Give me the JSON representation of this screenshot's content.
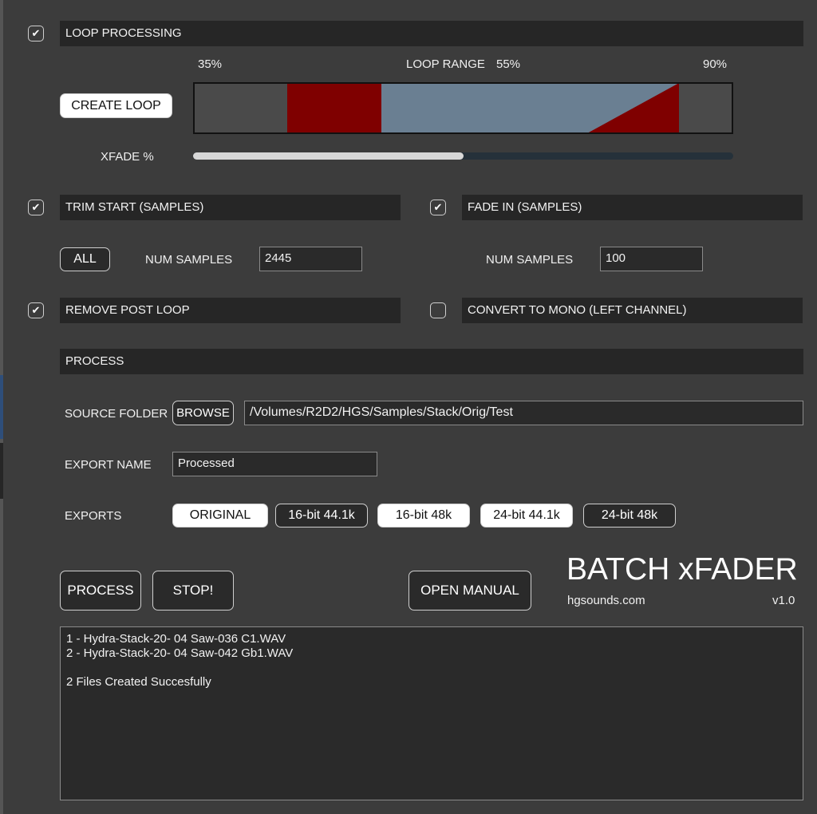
{
  "loop": {
    "checked": true,
    "header": "LOOP PROCESSING",
    "range_start": "35%",
    "range_label": "LOOP RANGE",
    "range_mid": "55%",
    "range_end": "90%",
    "create_button": "CREATE LOOP",
    "xfade_label": "XFADE %",
    "xfade_value": 0.5,
    "colors": {
      "loop_region": "#7f0000",
      "body": "#6a7f92",
      "outside": "#4a4a4a"
    }
  },
  "trim": {
    "checked": true,
    "header": "TRIM START (SAMPLES)",
    "all_button": "ALL",
    "num_label": "NUM SAMPLES",
    "num_value": "2445"
  },
  "fade": {
    "checked": true,
    "header": "FADE IN (SAMPLES)",
    "num_label": "NUM SAMPLES",
    "num_value": "100"
  },
  "remove_post": {
    "checked": true,
    "header": "REMOVE POST LOOP"
  },
  "mono": {
    "checked": false,
    "header": "CONVERT TO MONO (LEFT CHANNEL)"
  },
  "process": {
    "header": "PROCESS",
    "source_label": "SOURCE FOLDER",
    "browse_button": "BROWSE",
    "source_path": "/Volumes/R2D2/HGS/Samples/Stack/Orig/Test",
    "export_name_label": "EXPORT NAME",
    "export_name_value": "Processed",
    "exports_label": "EXPORTS",
    "exports": [
      {
        "label": "ORIGINAL",
        "selected": true
      },
      {
        "label": "16-bit 44.1k",
        "selected": false
      },
      {
        "label": "16-bit 48k",
        "selected": true
      },
      {
        "label": "24-bit 44.1k",
        "selected": true
      },
      {
        "label": "24-bit 48k",
        "selected": false
      }
    ]
  },
  "actions": {
    "process_button": "PROCESS",
    "stop_button": "STOP!",
    "manual_button": "OPEN MANUAL"
  },
  "brand": {
    "title": "BATCH xFADER",
    "site": "hgsounds.com",
    "version": "v1.0"
  },
  "log": {
    "lines": [
      "1 - Hydra-Stack-20- 04 Saw-036 C1.WAV",
      "2 - Hydra-Stack-20- 04 Saw-042 Gb1.WAV",
      "",
      "2 Files Created Succesfully"
    ]
  }
}
